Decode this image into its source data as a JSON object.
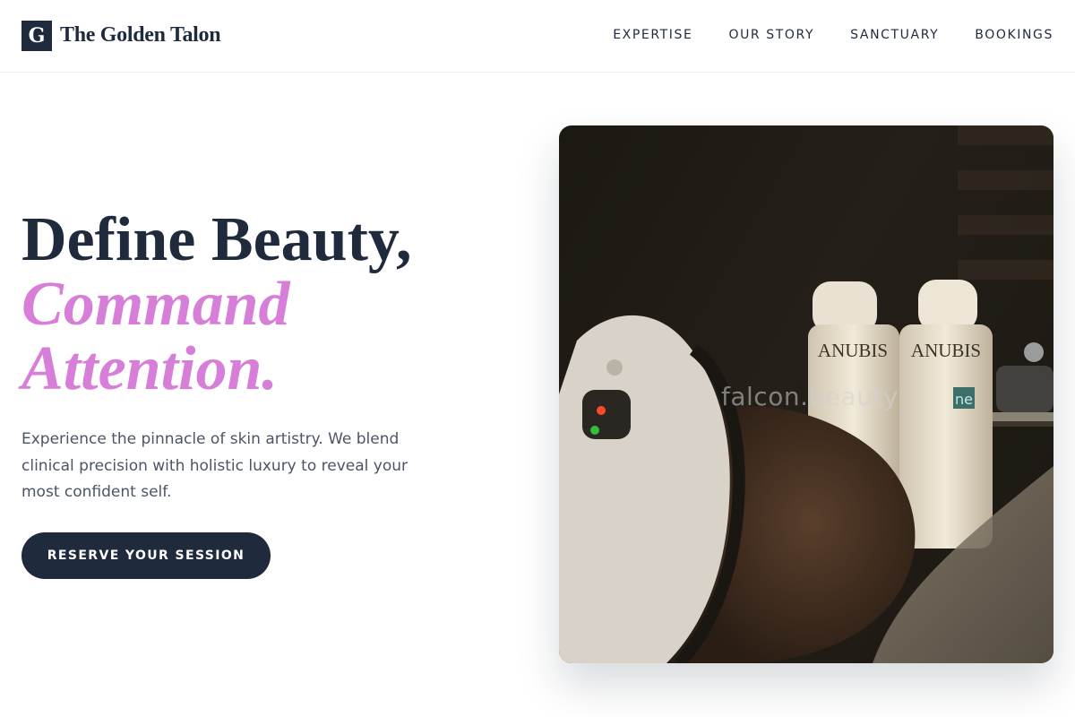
{
  "brand": {
    "mark": "G",
    "name": "The Golden Talon"
  },
  "nav": [
    {
      "label": "EXPERTISE"
    },
    {
      "label": "OUR STORY"
    },
    {
      "label": "SANCTUARY"
    },
    {
      "label": "BOOKINGS"
    }
  ],
  "hero": {
    "headline_line1": "Define Beauty,",
    "headline_line2": "Command",
    "headline_line3": "Attention.",
    "description": "Experience the pinnacle of skin artistry. We blend clinical precision with holistic luxury to reveal your most confident self.",
    "cta_label": "RESERVE YOUR SESSION"
  },
  "image": {
    "watermark": "falcon.beauty",
    "bottle_brand": "ANUBIS",
    "bottle_tag": "ne"
  },
  "colors": {
    "navy": "#1f2a3d",
    "accent": "#d77ed9",
    "body_text": "#4b5565"
  }
}
